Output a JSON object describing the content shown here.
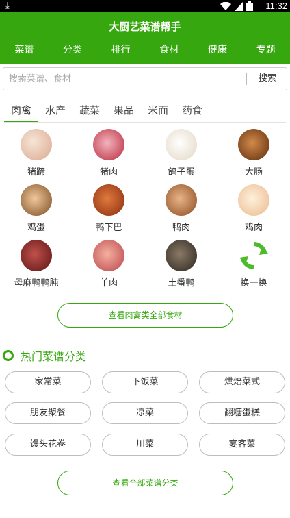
{
  "status_bar": {
    "time": "11:32",
    "download_icon": "download-icon"
  },
  "app": {
    "title": "大厨艺菜谱帮手"
  },
  "nav": [
    {
      "label": "菜谱"
    },
    {
      "label": "分类"
    },
    {
      "label": "排行"
    },
    {
      "label": "食材"
    },
    {
      "label": "健康"
    },
    {
      "label": "专题"
    }
  ],
  "search": {
    "placeholder": "搜索菜谱、食材",
    "button": "搜索"
  },
  "tabs": [
    {
      "label": "肉禽",
      "active": true
    },
    {
      "label": "水产"
    },
    {
      "label": "蔬菜"
    },
    {
      "label": "果品"
    },
    {
      "label": "米面"
    },
    {
      "label": "药食"
    }
  ],
  "ingredients": [
    {
      "label": "猪蹄",
      "color": "#e8c9b5"
    },
    {
      "label": "猪肉",
      "color": "#c9485a"
    },
    {
      "label": "鸽子蛋",
      "color": "#efe6d6"
    },
    {
      "label": "大肠",
      "color": "#a0571d"
    },
    {
      "label": "鸡蛋",
      "color": "#c98a4a"
    },
    {
      "label": "鸭下巴",
      "color": "#b34a1e"
    },
    {
      "label": "鸭肉",
      "color": "#b26a35"
    },
    {
      "label": "鸡肉",
      "color": "#f1cfae"
    },
    {
      "label": "母麻鸭鸭肫",
      "color": "#7a2c2c"
    },
    {
      "label": "羊肉",
      "color": "#d46a6a"
    },
    {
      "label": "土番鸭",
      "color": "#4c4138"
    },
    {
      "label": "换一换",
      "color": "#ffffff"
    }
  ],
  "more_ingredients_button": "查看肉禽类全部食材",
  "hot": {
    "title": "热门菜谱分类",
    "items": [
      {
        "label": "家常菜"
      },
      {
        "label": "下饭菜"
      },
      {
        "label": "烘焙菜式"
      },
      {
        "label": "朋友聚餐"
      },
      {
        "label": "凉菜"
      },
      {
        "label": "翻糖蛋糕"
      },
      {
        "label": "馒头花卷"
      },
      {
        "label": "川菜"
      },
      {
        "label": "宴客菜"
      }
    ],
    "more_button": "查看全部菜谱分类"
  },
  "colors": {
    "brand": "#36a70e",
    "statusbar": "#000000"
  }
}
